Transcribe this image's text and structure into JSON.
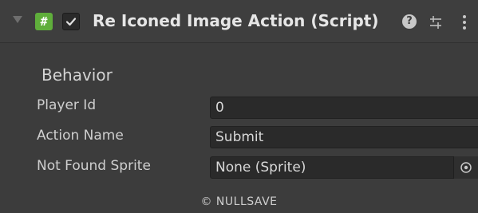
{
  "header": {
    "title": "Re Iconed Image Action (Script)",
    "script_icon_glyph": "#",
    "enabled": true,
    "icons": [
      "foldout-arrow-icon",
      "script-icon",
      "checkbox-check-icon",
      "help-icon",
      "presets-icon",
      "context-menu-icon"
    ],
    "help_glyph": "?"
  },
  "section": {
    "label": "Behavior"
  },
  "fields": [
    {
      "label": "Player Id",
      "value": "0"
    },
    {
      "label": "Action Name",
      "value": "Submit"
    },
    {
      "label": "Not Found Sprite",
      "value": "None (Sprite)"
    }
  ],
  "footer": {
    "text": "© NULLSAVE"
  },
  "colors": {
    "background": "#3c3c3c",
    "field_background": "#2a2a2a",
    "script_icon": "#5fae3b"
  }
}
